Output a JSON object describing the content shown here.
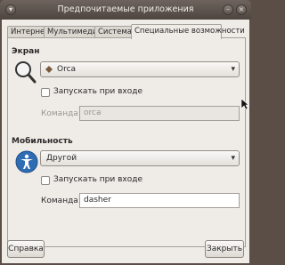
{
  "window": {
    "title": "Предпочитаемые приложения"
  },
  "tabs": [
    {
      "label": "Интернет"
    },
    {
      "label": "Мультимедиа"
    },
    {
      "label": "Система"
    },
    {
      "label": "Специальные возможности"
    }
  ],
  "screen": {
    "title": "Экран",
    "app_select": "Orca",
    "start_at_login": "Запускать при входе",
    "command_label": "Команда:",
    "command_value": "orca"
  },
  "mobility": {
    "title": "Мобильность",
    "app_select": "Другой",
    "start_at_login": "Запускать при входе",
    "command_label": "Команда:",
    "command_value": "dasher"
  },
  "footer": {
    "help_label": "Справка",
    "close_label": "Закрыть"
  },
  "icons": {
    "window_minimize": "minimize-icon",
    "window_close": "close-icon",
    "screen": "magnifier-icon",
    "mobility": "accessibility-icon",
    "app": "app-icon"
  },
  "colors": {
    "titlebar": "#4e4540",
    "accent": "#2e6db4"
  }
}
